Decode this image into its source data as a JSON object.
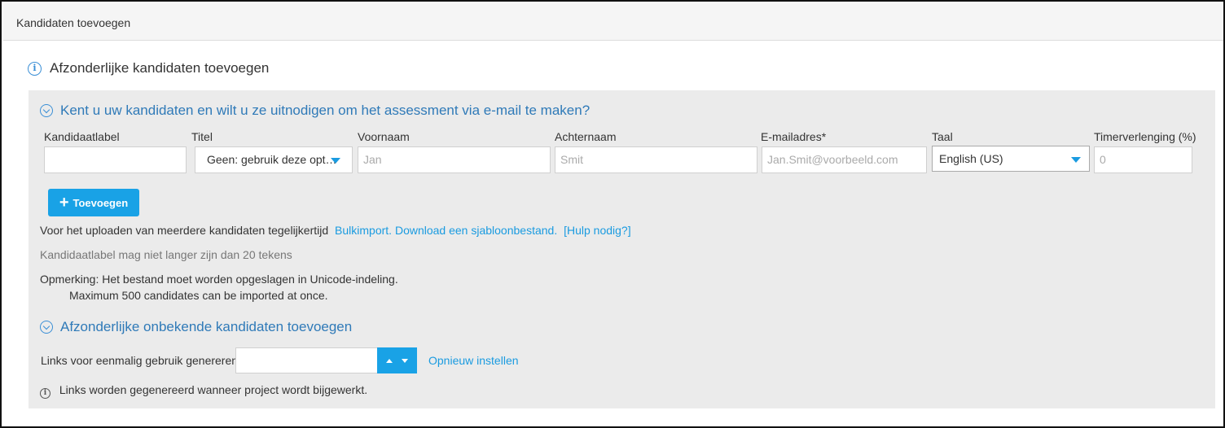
{
  "panel": {
    "title": "Kandidaten toevoegen"
  },
  "section": {
    "title": "Afzonderlijke kandidaten toevoegen",
    "icon": "info-icon"
  },
  "known": {
    "title": "Kent u uw kandidaten en wilt u ze uitnodigen om het assessment via e-mail te maken?",
    "columns": {
      "label": "Kandidaatlabel",
      "titel": "Titel",
      "voornaam": "Voornaam",
      "achternaam": "Achternaam",
      "email": "E-mailadres*",
      "taal": "Taal",
      "timer": "Timerverlenging (%)"
    },
    "fields": {
      "label_value": "",
      "titel_value": "Geen: gebruik deze opt…",
      "voornaam_placeholder": "Jan",
      "achternaam_placeholder": "Smit",
      "email_placeholder": "Jan.Smit@voorbeeld.com",
      "taal_value": "English (US)",
      "timer_placeholder": "0"
    },
    "add_button": "Toevoegen",
    "bulk_text": "Voor het uploaden van meerdere kandidaten tegelijkertijd",
    "bulk_link": "Bulkimport.",
    "template_link": "Download een sjabloonbestand.",
    "help_link": "[Hulp nodig?]",
    "label_note": "Kandidaatlabel mag niet langer zijn dan 20 tekens",
    "remark_line1": "Opmerking: Het bestand moet worden opgeslagen in Unicode-indeling.",
    "remark_line2": "Maximum 500 candidates can be imported at once."
  },
  "unknown": {
    "title": "Afzonderlijke onbekende kandidaten toevoegen",
    "links_label": "Links voor eenmalig gebruik genereren",
    "links_value": "",
    "reset_link": "Opnieuw instellen",
    "info_text": "Links worden gegenereerd wanneer project wordt bijgewerkt."
  },
  "colors": {
    "accent": "#19a2e6",
    "link": "#1a9be0",
    "heading_blue": "#2f7ab8",
    "box_bg": "#ebebeb"
  }
}
